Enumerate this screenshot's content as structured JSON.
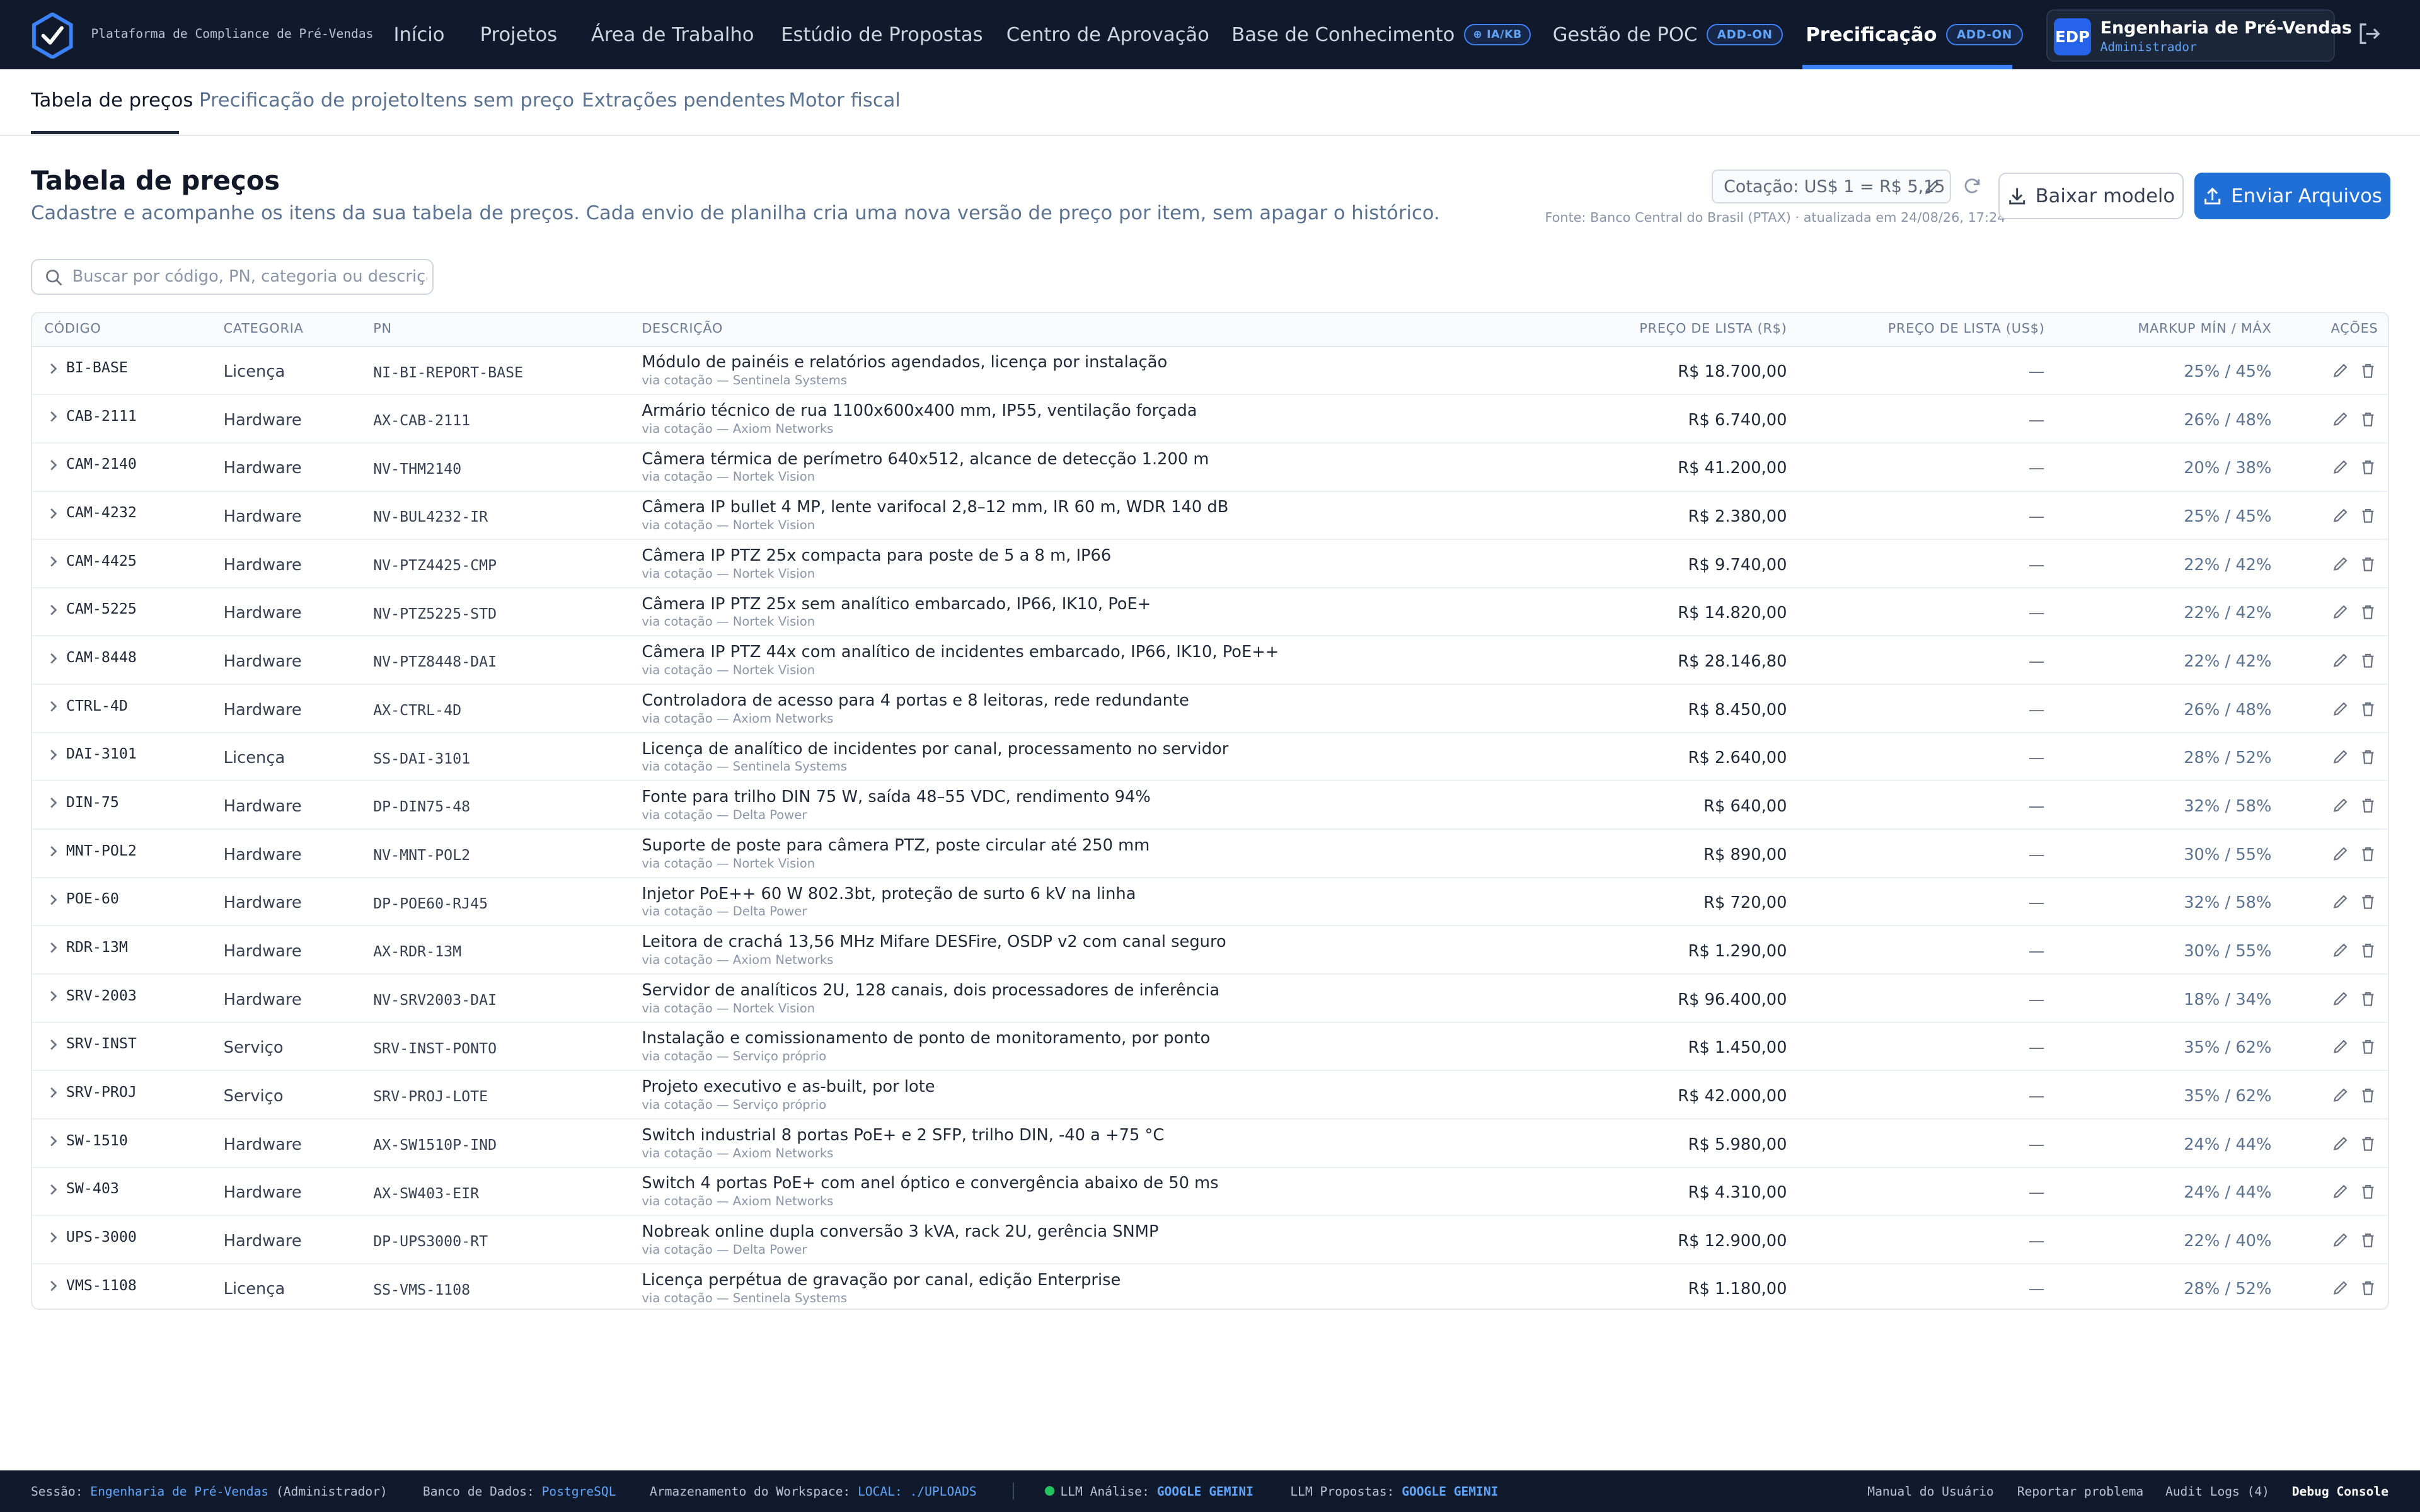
{
  "app": {
    "brand": "Plataforma de Compliance de Pré-Vendas",
    "nav": [
      {
        "label": "Início"
      },
      {
        "label": "Projetos"
      },
      {
        "label": "Área de Trabalho"
      },
      {
        "label": "Estúdio de Propostas"
      },
      {
        "label": "Centro de Aprovação"
      },
      {
        "label": "Base de Conhecimento",
        "badge": "IA/KB"
      },
      {
        "label": "Gestão de POC",
        "badge": "ADD-ON"
      },
      {
        "label": "Precificação",
        "badge": "ADD-ON",
        "active": true
      }
    ],
    "user": {
      "initials": "EDP",
      "name": "Engenharia de Pré-Vendas",
      "role": "Administrador"
    }
  },
  "subnav": [
    "Tabela de preços",
    "Precificação de projeto",
    "Itens sem preço",
    "Extrações pendentes",
    "Motor fiscal"
  ],
  "page": {
    "title": "Tabela de preços",
    "description": "Cadastre e acompanhe os itens da sua tabela de preços. Cada envio de planilha cria uma nova versão de preço por item, sem apagar o histórico.",
    "rate": "Cotação: US$ 1 = R$ 5,15",
    "rate_source": "Fonte: Banco Central do Brasil (PTAX) · atualizada em 24/08/26, 17:24",
    "download_label": "Baixar modelo",
    "upload_label": "Enviar Arquivos",
    "search_placeholder": "Buscar por código, PN, categoria ou descrição"
  },
  "table": {
    "headers": [
      "CÓDIGO",
      "CATEGORIA",
      "PN",
      "DESCRIÇÃO",
      "PREÇO DE LISTA (R$)",
      "PREÇO DE LISTA (US$)",
      "MARKUP MÍN / MÁX",
      "AÇÕES"
    ],
    "rows": [
      {
        "code": "BI-BASE",
        "category": "Licença",
        "pn": "NI-BI-REPORT-BASE",
        "description": "Módulo de painéis e relatórios agendados, licença por instalação",
        "source": "via cotação — Sentinela Systems",
        "price_brl": "R$ 18.700,00",
        "price_usd": "—",
        "markup": "25% / 45%"
      },
      {
        "code": "CAB-2111",
        "category": "Hardware",
        "pn": "AX-CAB-2111",
        "description": "Armário técnico de rua 1100x600x400 mm, IP55, ventilação forçada",
        "source": "via cotação — Axiom Networks",
        "price_brl": "R$ 6.740,00",
        "price_usd": "—",
        "markup": "26% / 48%"
      },
      {
        "code": "CAM-2140",
        "category": "Hardware",
        "pn": "NV-THM2140",
        "description": "Câmera térmica de perímetro 640x512, alcance de detecção 1.200 m",
        "source": "via cotação — Nortek Vision",
        "price_brl": "R$ 41.200,00",
        "price_usd": "—",
        "markup": "20% / 38%"
      },
      {
        "code": "CAM-4232",
        "category": "Hardware",
        "pn": "NV-BUL4232-IR",
        "description": "Câmera IP bullet 4 MP, lente varifocal 2,8–12 mm, IR 60 m, WDR 140 dB",
        "source": "via cotação — Nortek Vision",
        "price_brl": "R$ 2.380,00",
        "price_usd": "—",
        "markup": "25% / 45%"
      },
      {
        "code": "CAM-4425",
        "category": "Hardware",
        "pn": "NV-PTZ4425-CMP",
        "description": "Câmera IP PTZ 25x compacta para poste de 5 a 8 m, IP66",
        "source": "via cotação — Nortek Vision",
        "price_brl": "R$ 9.740,00",
        "price_usd": "—",
        "markup": "22% / 42%"
      },
      {
        "code": "CAM-5225",
        "category": "Hardware",
        "pn": "NV-PTZ5225-STD",
        "description": "Câmera IP PTZ 25x sem analítico embarcado, IP66, IK10, PoE+",
        "source": "via cotação — Nortek Vision",
        "price_brl": "R$ 14.820,00",
        "price_usd": "—",
        "markup": "22% / 42%"
      },
      {
        "code": "CAM-8448",
        "category": "Hardware",
        "pn": "NV-PTZ8448-DAI",
        "description": "Câmera IP PTZ 44x com analítico de incidentes embarcado, IP66, IK10, PoE++",
        "source": "via cotação — Nortek Vision",
        "price_brl": "R$ 28.146,80",
        "price_usd": "—",
        "markup": "22% / 42%"
      },
      {
        "code": "CTRL-4D",
        "category": "Hardware",
        "pn": "AX-CTRL-4D",
        "description": "Controladora de acesso para 4 portas e 8 leitoras, rede redundante",
        "source": "via cotação — Axiom Networks",
        "price_brl": "R$ 8.450,00",
        "price_usd": "—",
        "markup": "26% / 48%"
      },
      {
        "code": "DAI-3101",
        "category": "Licença",
        "pn": "SS-DAI-3101",
        "description": "Licença de analítico de incidentes por canal, processamento no servidor",
        "source": "via cotação — Sentinela Systems",
        "price_brl": "R$ 2.640,00",
        "price_usd": "—",
        "markup": "28% / 52%"
      },
      {
        "code": "DIN-75",
        "category": "Hardware",
        "pn": "DP-DIN75-48",
        "description": "Fonte para trilho DIN 75 W, saída 48–55 VDC, rendimento 94%",
        "source": "via cotação — Delta Power",
        "price_brl": "R$ 640,00",
        "price_usd": "—",
        "markup": "32% / 58%"
      },
      {
        "code": "MNT-POL2",
        "category": "Hardware",
        "pn": "NV-MNT-POL2",
        "description": "Suporte de poste para câmera PTZ, poste circular até 250 mm",
        "source": "via cotação — Nortek Vision",
        "price_brl": "R$ 890,00",
        "price_usd": "—",
        "markup": "30% / 55%"
      },
      {
        "code": "POE-60",
        "category": "Hardware",
        "pn": "DP-POE60-RJ45",
        "description": "Injetor PoE++ 60 W 802.3bt, proteção de surto 6 kV na linha",
        "source": "via cotação — Delta Power",
        "price_brl": "R$ 720,00",
        "price_usd": "—",
        "markup": "32% / 58%"
      },
      {
        "code": "RDR-13M",
        "category": "Hardware",
        "pn": "AX-RDR-13M",
        "description": "Leitora de crachá 13,56 MHz Mifare DESFire, OSDP v2 com canal seguro",
        "source": "via cotação — Axiom Networks",
        "price_brl": "R$ 1.290,00",
        "price_usd": "—",
        "markup": "30% / 55%"
      },
      {
        "code": "SRV-2003",
        "category": "Hardware",
        "pn": "NV-SRV2003-DAI",
        "description": "Servidor de analíticos 2U, 128 canais, dois processadores de inferência",
        "source": "via cotação — Nortek Vision",
        "price_brl": "R$ 96.400,00",
        "price_usd": "—",
        "markup": "18% / 34%"
      },
      {
        "code": "SRV-INST",
        "category": "Serviço",
        "pn": "SRV-INST-PONTO",
        "description": "Instalação e comissionamento de ponto de monitoramento, por ponto",
        "source": "via cotação — Serviço próprio",
        "price_brl": "R$ 1.450,00",
        "price_usd": "—",
        "markup": "35% / 62%"
      },
      {
        "code": "SRV-PROJ",
        "category": "Serviço",
        "pn": "SRV-PROJ-LOTE",
        "description": "Projeto executivo e as-built, por lote",
        "source": "via cotação — Serviço próprio",
        "price_brl": "R$ 42.000,00",
        "price_usd": "—",
        "markup": "35% / 62%"
      },
      {
        "code": "SW-1510",
        "category": "Hardware",
        "pn": "AX-SW1510P-IND",
        "description": "Switch industrial 8 portas PoE+ e 2 SFP, trilho DIN, -40 a +75 °C",
        "source": "via cotação — Axiom Networks",
        "price_brl": "R$ 5.980,00",
        "price_usd": "—",
        "markup": "24% / 44%"
      },
      {
        "code": "SW-403",
        "category": "Hardware",
        "pn": "AX-SW403-EIR",
        "description": "Switch 4 portas PoE+ com anel óptico e convergência abaixo de 50 ms",
        "source": "via cotação — Axiom Networks",
        "price_brl": "R$ 4.310,00",
        "price_usd": "—",
        "markup": "24% / 44%"
      },
      {
        "code": "UPS-3000",
        "category": "Hardware",
        "pn": "DP-UPS3000-RT",
        "description": "Nobreak online dupla conversão 3 kVA, rack 2U, gerência SNMP",
        "source": "via cotação — Delta Power",
        "price_brl": "R$ 12.900,00",
        "price_usd": "—",
        "markup": "22% / 40%"
      },
      {
        "code": "VMS-1108",
        "category": "Licença",
        "pn": "SS-VMS-1108",
        "description": "Licença perpétua de gravação por canal, edição Enterprise",
        "source": "via cotação — Sentinela Systems",
        "price_brl": "R$ 1.180,00",
        "price_usd": "—",
        "markup": "28% / 52%"
      }
    ]
  },
  "footer": {
    "session_label": "Sessão:",
    "session_user": "Engenharia de Pré-Vendas",
    "session_role": "(Administrador)",
    "db_label": "Banco de Dados:",
    "db_value": "PostgreSQL",
    "storage_label": "Armazenamento do Workspace:",
    "storage_value": "LOCAL: ./UPLOADS",
    "llm_analysis_label": "LLM Análise:",
    "llm_analysis_value": "GOOGLE GEMINI",
    "llm_proposals_label": "LLM Propostas:",
    "llm_proposals_value": "GOOGLE GEMINI",
    "links": [
      "Manual do Usuário",
      "Reportar problema",
      "Audit Logs (4)",
      "Debug Console"
    ]
  },
  "colors": {
    "topbar": "#111a2c",
    "accent": "#3b82f6",
    "primary_button": "#1f6fd6",
    "status_ok": "#22c55e"
  }
}
